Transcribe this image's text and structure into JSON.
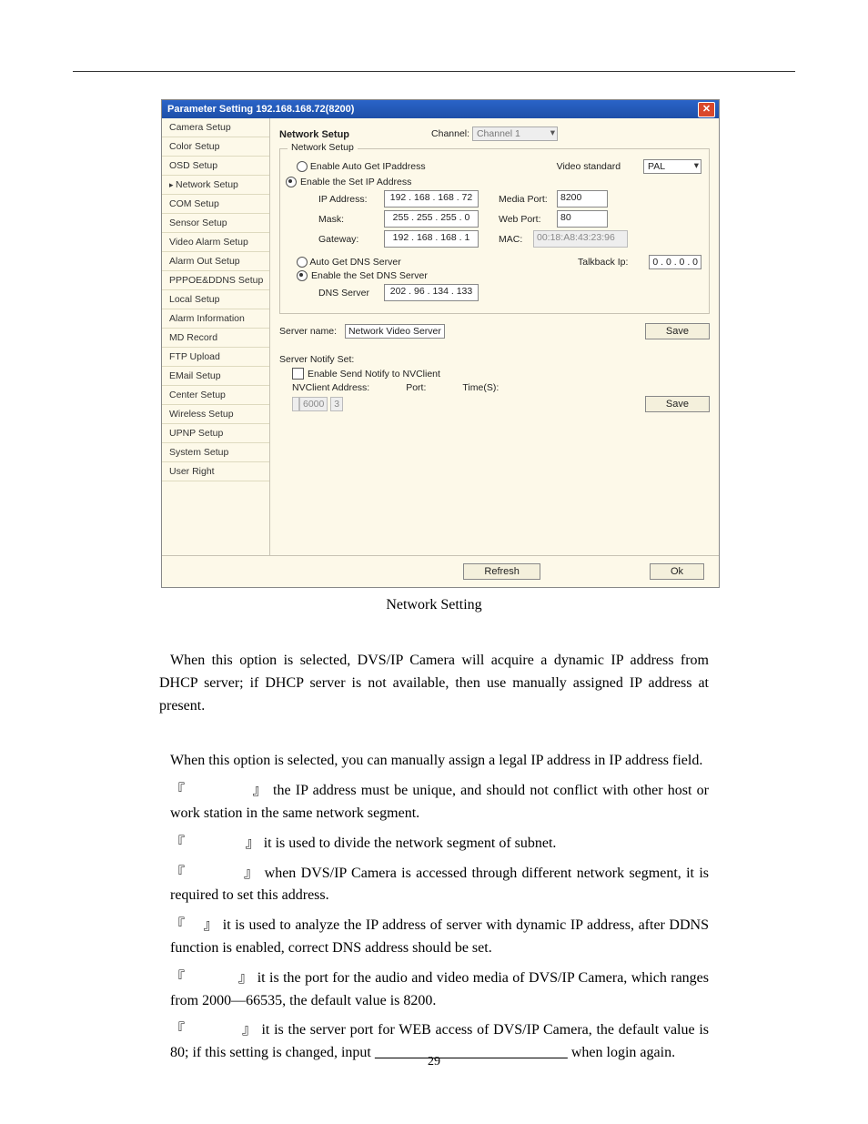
{
  "titlebar": {
    "text": "Parameter Setting 192.168.168.72(8200)"
  },
  "sidebar": {
    "items": [
      "Camera Setup",
      "Color Setup",
      "OSD Setup",
      "Network Setup",
      "COM Setup",
      "Sensor Setup",
      "Video Alarm Setup",
      "Alarm Out Setup",
      "PPPOE&DDNS Setup",
      "Local Setup",
      "Alarm Information",
      "MD Record",
      "FTP Upload",
      "EMail Setup",
      "Center Setup",
      "Wireless Setup",
      "UPNP Setup",
      "System Setup",
      "User Right"
    ],
    "selected_index": 3
  },
  "header": {
    "section_label": "Network Setup",
    "channel_label": "Channel:",
    "channel_value": "Channel 1"
  },
  "net_group": {
    "legend": "Network Setup",
    "radio_auto": "Enable Auto Get IPaddress",
    "radio_set": "Enable the Set IP Address",
    "video_std_label": "Video standard",
    "video_std_value": "PAL",
    "ip_label": "IP Address:",
    "ip_value": "192 . 168 . 168 . 72",
    "mask_label": "Mask:",
    "mask_value": "255 . 255 . 255 .  0",
    "gw_label": "Gateway:",
    "gw_value": "192 . 168 . 168 .  1",
    "media_label": "Media Port:",
    "media_value": "8200",
    "web_label": "Web Port:",
    "web_value": "80",
    "mac_label": "MAC:",
    "mac_value": "00:18:A8:43:23:96",
    "radio_autodns": "Auto Get DNS Server",
    "radio_setdns": "Enable the Set DNS Server",
    "talkback_label": "Talkback Ip:",
    "talkback_value": "0  .  0  .  0  .  0",
    "dns_label": "DNS Server",
    "dns_value": "202 . 96 . 134 . 133"
  },
  "server_name": {
    "label": "Server name:",
    "value": "Network Video Server",
    "save": "Save"
  },
  "notify": {
    "heading": "Server Notify Set:",
    "enable": "Enable Send Notify to NVClient",
    "addr_label": "NVClient Address:",
    "port_label": "Port:",
    "times_label": "Time(S):",
    "port_value": "6000",
    "times_value": "3",
    "save": "Save"
  },
  "bottom": {
    "refresh": "Refresh",
    "ok": "Ok"
  },
  "caption": "Network Setting",
  "para1": "When this option is selected, DVS/IP Camera will acquire a dynamic IP address from DHCP server; if DHCP server is not available, then use manually assigned IP address at present.",
  "para2": "When this option is selected, you can manually assign a legal IP address in IP address field.",
  "li_ip": "the IP address must be unique, and should not conflict with other host or work station in the same network segment.",
  "li_mask": "it is used to divide the network segment of subnet.",
  "li_gw": "when DVS/IP Camera is accessed through different network segment, it is required to set this address.",
  "li_dns": "it is used to analyze the IP address of server with dynamic IP address, after DDNS function is enabled, correct DNS address should be set.",
  "li_media": "it is the port for the audio and video media of DVS/IP Camera, which ranges from 2000—66535, the default value is 8200.",
  "li_web1": "it is the server port for WEB access of DVS/IP Camera, the default value is 80; if this setting is changed, input ",
  "li_web2": " when login again.",
  "pageno": "29"
}
